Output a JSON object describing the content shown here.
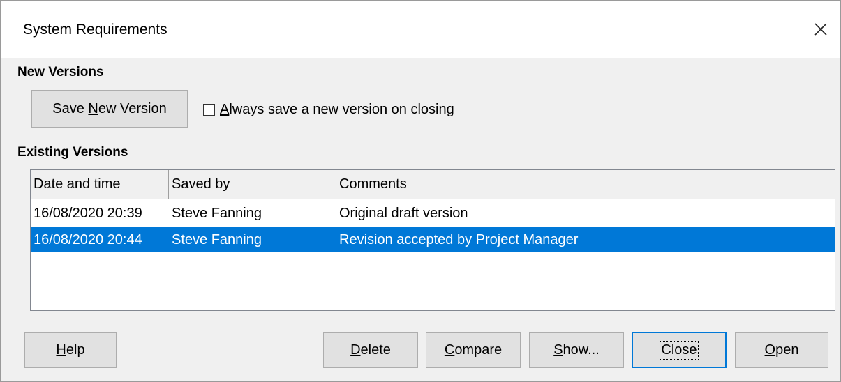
{
  "window": {
    "title": "System Requirements",
    "close_icon": "close-icon"
  },
  "new_versions": {
    "heading": "New Versions",
    "save_button": {
      "pre": "Save ",
      "mnemonic": "N",
      "post": "ew Version"
    },
    "checkbox": {
      "mnemonic": "A",
      "rest": "lways save a new version on closing",
      "checked": false
    }
  },
  "existing_versions": {
    "heading": "Existing Versions",
    "columns": [
      "Date and time",
      "Saved by",
      "Comments"
    ],
    "rows": [
      {
        "date": "16/08/2020 20:39",
        "saved_by": "Steve Fanning",
        "comment": "Original draft version",
        "selected": false
      },
      {
        "date": "16/08/2020 20:44",
        "saved_by": "Steve Fanning",
        "comment": "Revision accepted by Project Manager",
        "selected": true
      }
    ]
  },
  "buttons": {
    "help": {
      "mnemonic": "H",
      "rest": "elp"
    },
    "delete": {
      "mnemonic": "D",
      "rest": "elete"
    },
    "compare": {
      "mnemonic": "C",
      "rest": "ompare"
    },
    "show": {
      "mnemonic": "S",
      "rest": "how..."
    },
    "close": {
      "text": "Close"
    },
    "open": {
      "mnemonic": "O",
      "rest": "pen"
    }
  },
  "colors": {
    "selection": "#0078d7",
    "dialog_bg": "#f0f0f0"
  }
}
